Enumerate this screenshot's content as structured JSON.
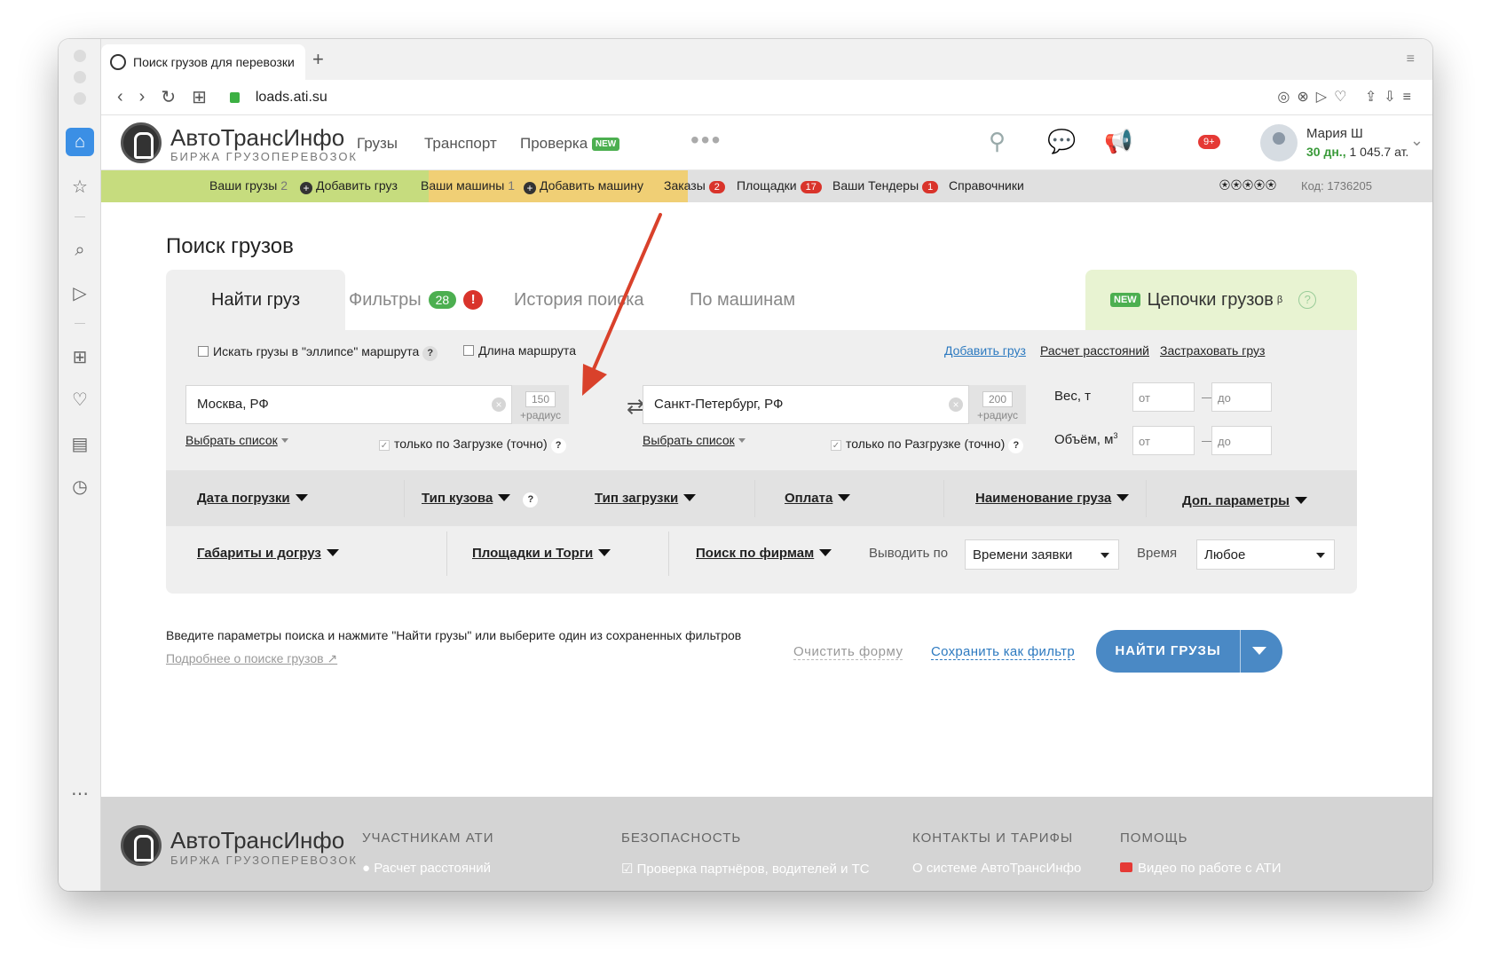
{
  "browser": {
    "tab_title": "Поиск грузов для перевозки",
    "url": "loads.ati.su",
    "new_tab_icon": "plus-icon"
  },
  "header": {
    "brand": "АвтоТрансИнфо",
    "brand_sub": "БИРЖА ГРУЗОПЕРЕВОЗОК",
    "nav": [
      "Грузы",
      "Транспорт",
      "Проверка"
    ],
    "new_tag": "NEW",
    "notifications_badge": "9+",
    "user_name": "Мария Ш",
    "user_days": "30 дн.,",
    "user_balance": "1 045.7 ат."
  },
  "subbar": {
    "your_loads": "Ваши грузы",
    "your_loads_count": "2",
    "add_load": "Добавить груз",
    "your_trucks": "Ваши машины",
    "your_trucks_count": "1",
    "add_truck": "Добавить машину",
    "orders": "Заказы",
    "orders_count": "2",
    "platforms": "Площадки",
    "platforms_count": "17",
    "tenders": "Ваши Тендеры",
    "tenders_count": "1",
    "references": "Справочники",
    "code": "Код: 1736205"
  },
  "page": {
    "title": "Поиск грузов"
  },
  "tabs": {
    "find": "Найти груз",
    "filters": "Фильтры",
    "filters_count": "28",
    "filters_alert": "!",
    "history": "История поиска",
    "by_trucks": "По машинам",
    "chains_new": "NEW",
    "chains": "Цепочки грузов",
    "chains_sup": "β",
    "chains_help": "?"
  },
  "form": {
    "ellipse_label": "Искать грузы в \"эллипсе\" маршрута",
    "route_length_label": "Длина маршрута",
    "help": "?",
    "add_load_link": "Добавить груз",
    "distance_link": "Расчет расстояний",
    "insure_link": "Застраховать груз",
    "from_city": "Москва, РФ",
    "from_radius": "150",
    "to_city": "Санкт-Петербург, РФ",
    "to_radius": "200",
    "radius_label": "+радиус",
    "select_list": "Выбрать список",
    "only_loading": "только по Загрузке (точно)",
    "only_unloading": "только по Разгрузке (точно)",
    "weight_label": "Вес, т",
    "volume_label": "Объём, м",
    "volume_sup": "3",
    "from_ph": "от",
    "to_ph": "до",
    "dash": "—"
  },
  "filters_row1": {
    "load_date": "Дата погрузки",
    "body_type": "Тип кузова",
    "loading_type": "Тип загрузки",
    "payment": "Оплата",
    "cargo_name": "Наименование груза",
    "extra": "Доп. параметры"
  },
  "filters_row2": {
    "dimensions": "Габариты и догруз",
    "platforms": "Площадки и Торги",
    "firms": "Поиск по фирмам",
    "sort_label": "Выводить по",
    "sort_value": "Времени заявки",
    "time_label": "Время",
    "time_value": "Любое"
  },
  "actions": {
    "hint": "Введите параметры поиска и нажмите \"Найти грузы\" или выберите один из сохраненных фильтров",
    "more_link": "Подробнее о поиске грузов",
    "clear": "Очистить форму",
    "save_filter": "Сохранить как фильтр",
    "find": "НАЙТИ ГРУЗЫ"
  },
  "footer": {
    "brand": "АвтоТрансИнфо",
    "brand_sub": "БИРЖА ГРУЗОПЕРЕВОЗОК",
    "col1_title": "УЧАСТНИКАМ АТИ",
    "col1_item": "Расчет расстояний",
    "col2_title": "БЕЗОПАСНОСТЬ",
    "col2_item": "Проверка партнёров, водителей и ТС",
    "col3_title": "КОНТАКТЫ И ТАРИФЫ",
    "col3_item": "О системе АвтоТрансИнфо",
    "col4_title": "ПОМОЩЬ",
    "col4_item": "Видео по работе с АТИ"
  },
  "annotation": {
    "arrow_color": "#d9412b"
  },
  "colors": {
    "accent_blue": "#4a89c5",
    "green_badge": "#4caf50",
    "red_badge": "#d9342b",
    "loads_bar": "#c6dc7e",
    "trucks_bar": "#f0cf75"
  }
}
